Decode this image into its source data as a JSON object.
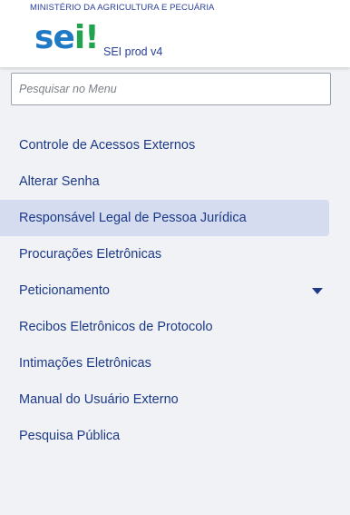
{
  "header": {
    "organization": "MINISTÉRIO DA AGRICULTURA E PECUÁRIA",
    "logo_text": "sei!",
    "system_label": "SEI prod v4"
  },
  "search": {
    "placeholder": "Pesquisar no Menu",
    "value": ""
  },
  "menu": {
    "items": [
      {
        "label": "Controle de Acessos Externos"
      },
      {
        "label": "Alterar Senha"
      },
      {
        "label": "Responsável Legal de Pessoa Jurídica",
        "active": true
      },
      {
        "label": "Procurações Eletrônicas"
      },
      {
        "label": "Peticionamento",
        "icon": "caret-down-icon"
      },
      {
        "label": "Recibos Eletrônicos de Protocolo"
      },
      {
        "label": "Intimações Eletrônicas"
      },
      {
        "label": "Manual do Usuário Externo"
      },
      {
        "label": "Pesquisa Pública"
      }
    ]
  },
  "colors": {
    "brand_blue": "#1f79c4",
    "brand_green": "#23a34f",
    "text_navy": "#1d3a87",
    "active_bg": "#d5dcef",
    "sidebar_bg": "#f1f2f5"
  }
}
